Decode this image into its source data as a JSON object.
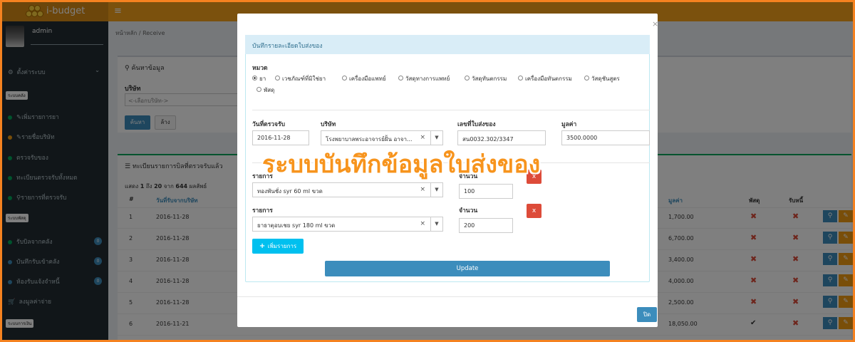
{
  "app": {
    "brand": "i-budget",
    "menu_icon": "hamburger-icon"
  },
  "user": {
    "name": "admin"
  },
  "sidebar": {
    "settings": "ตั้งค่าระบบ",
    "group1_header": "ระบบคลัง",
    "group1_items": [
      "เพิ่มรายการยา",
      "รายชื่อบริษัท",
      "ตรวจรับของ",
      "ทะเบียนตรวจรับทั้งหมด",
      "รายการที่ตรวจรับ"
    ],
    "group2_header": "ระบบพัสดุ",
    "group2_items": [
      "รับบิลจากคลัง",
      "บันทึกรับเข้าคลัง",
      "ห้องรับแจ้งจำหนี้",
      "ลงมูลค่าจ่าย"
    ],
    "group2_badges": [
      "0",
      "0",
      "0"
    ],
    "group3_header": "ระบบการเงิน"
  },
  "breadcrumb": {
    "home": "หน้าหลัก",
    "sep": "/",
    "current": "Receive"
  },
  "search": {
    "title": "ค้นหาข้อมูล",
    "company_label": "บริษัท",
    "company_placeholder": "<-เลือกบริษัท->",
    "search_button": "ค้นหา",
    "clear_button": "ล้าง"
  },
  "list": {
    "title": "ทะเบียนรายการบิลที่ตรวจรับแล้ว",
    "info_prefix": "แสดง",
    "info_from": "1",
    "info_to_word": "ถึง",
    "info_to": "20",
    "info_of_word": "จาก",
    "info_total": "644",
    "info_suffix": "ผลลัพธ์",
    "headers": [
      "#",
      "วันที่รับจากบริษัท",
      "มูลค่า",
      "พัสดุ",
      "รับหนี้"
    ],
    "rows": [
      {
        "no": "1",
        "date": "2016-11-28",
        "amount": "1,700.00",
        "parcel": "x",
        "debt": "x"
      },
      {
        "no": "2",
        "date": "2016-11-28",
        "amount": "6,700.00",
        "parcel": "x",
        "debt": "x"
      },
      {
        "no": "3",
        "date": "2016-11-28",
        "amount": "3,400.00",
        "parcel": "x",
        "debt": "x"
      },
      {
        "no": "4",
        "date": "2016-11-28",
        "amount": "4,000.00",
        "parcel": "x",
        "debt": "x"
      },
      {
        "no": "5",
        "date": "2016-11-28",
        "amount": "2,500.00",
        "parcel": "x",
        "debt": "x"
      },
      {
        "no": "6",
        "date": "2016-11-21",
        "amount": "18,050.00",
        "parcel": "check",
        "debt": "x"
      }
    ]
  },
  "modal": {
    "close_x": "×",
    "panel_title": "บันทึกรายละเอียดใบส่งของ",
    "category_label": "หมวด",
    "categories": [
      "ยา",
      "เวชภัณฑ์ที่มิใช่ยา",
      "เครื่องมือแพทย์",
      "วัสดุทางการแพทย์",
      "วัสดุทันตกรรม",
      "เครื่องมือทันตกรรม",
      "วัสดุชันสูตร",
      "พัสดุ"
    ],
    "selected_category": "ยา",
    "fields": {
      "date_label": "วันที่ตรวจรับ",
      "date_value": "2016-11-28",
      "company_label": "บริษัท",
      "company_value": "โรงพยาบาลพระอาจารย์ฝั้น อาจา...",
      "invoice_label": "เลขที่ใบส่งของ",
      "invoice_value": "สน0032.302/3347",
      "value_label": "มูลค่า",
      "value_value": "3500.0000"
    },
    "items": [
      {
        "item_label": "รายการ",
        "item_value": "ทองพันชั่ง syr 60 ml ขวด",
        "qty_label": "จำนวน",
        "qty_value": "100",
        "delete": "x"
      },
      {
        "item_label": "รายการ",
        "item_value": "ยาธาตุอบเชย syr 180 ml ขวด",
        "qty_label": "จำนวน",
        "qty_value": "200",
        "delete": "x"
      }
    ],
    "add_button": "เพิ่มรายการ",
    "update_button": "Update",
    "close_button": "ปิด"
  },
  "banner": "ระบบบันทึกข้อมูลใบส่งของ"
}
